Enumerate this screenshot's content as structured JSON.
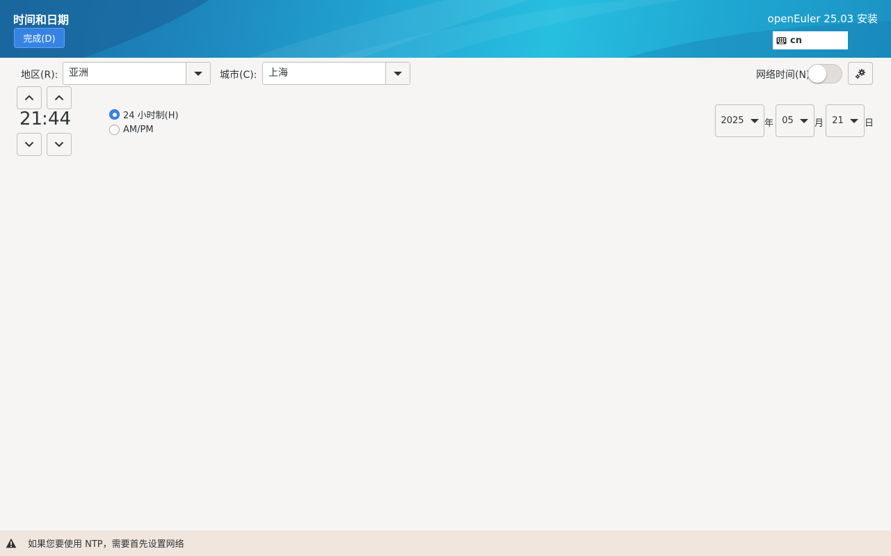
{
  "header": {
    "title": "时间和日期",
    "done_label": "完成(D)",
    "product": "openEuler 25.03 安装",
    "keyboard_layout": "cn",
    "accent_color": "#22a8d4"
  },
  "location": {
    "region_label": "地区(R):",
    "region_value": "亚洲",
    "city_label": "城市(C):",
    "city_value": "上海"
  },
  "network_time": {
    "label": "网络时间(N)",
    "enabled": false,
    "settings_icon": "gear-icon"
  },
  "time": {
    "hours": "21",
    "separator": ":",
    "minutes": "44",
    "format_options": [
      {
        "label": "24 小时制(H)",
        "selected": true
      },
      {
        "label": "AM/PM",
        "selected": false
      }
    ]
  },
  "date": {
    "year": "2025",
    "year_unit": "年",
    "month": "05",
    "month_unit": "月",
    "day": "21",
    "day_unit": "日"
  },
  "infobar": {
    "icon": "warning-icon",
    "message": "如果您要使用 NTP，需要首先设置网络"
  }
}
